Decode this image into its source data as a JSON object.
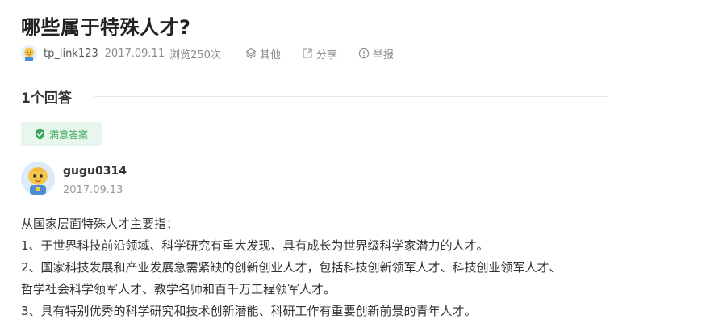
{
  "question": {
    "title": "哪些属于特殊人才?",
    "author": "tp_link123",
    "date": "2017.09.11",
    "views": "浏览250次",
    "actions": {
      "other": "其他",
      "share": "分享",
      "report": "举报"
    }
  },
  "answers_header": {
    "count_label": "1个回答"
  },
  "answer": {
    "badge": "满意答案",
    "author": "gugu0314",
    "date": "2017.09.13",
    "paragraphs": [
      "从国家层面特殊人才主要指：",
      "1、于世界科技前沿领域、科学研究有重大发现、具有成长为世界级科学家潜力的人才。",
      "2、国家科技发展和产业发展急需紧缺的创新创业人才，包括科技创新领军人才、科技创业领军人才、",
      "哲学社会科学领军人才、教学名师和百千万工程领军人才。",
      "3、具有特别优秀的科学研究和技术创新潜能、科研工作有重要创新前景的青年人才。"
    ]
  },
  "colors": {
    "badge_text": "#3aa85c",
    "badge_bg": "#e9f6ee",
    "meta_text": "#8a8a8a"
  },
  "icons": {
    "other": "layers-icon",
    "share": "share-icon",
    "report": "info-circle-icon",
    "badge": "shield-check-icon"
  }
}
